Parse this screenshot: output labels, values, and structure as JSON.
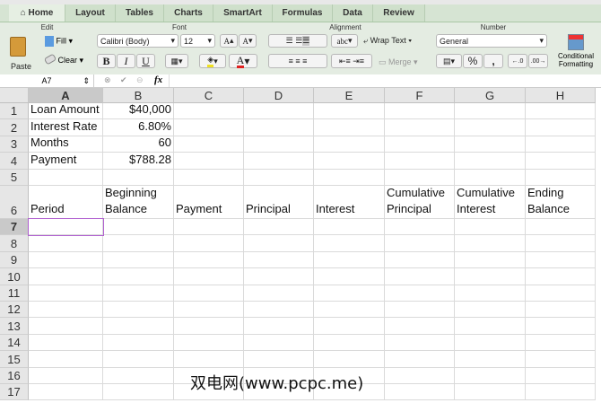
{
  "tabs": [
    "Home",
    "Layout",
    "Tables",
    "Charts",
    "SmartArt",
    "Formulas",
    "Data",
    "Review"
  ],
  "ribbon": {
    "groups": {
      "edit": "Edit",
      "font": "Font",
      "alignment": "Alignment",
      "number": "Number"
    },
    "paste": "Paste",
    "fill": "Fill",
    "clear": "Clear",
    "font_name": "Calibri (Body)",
    "font_size": "12",
    "bold": "B",
    "italic": "I",
    "underline": "U",
    "wrap_text": "Wrap Text",
    "merge": "Merge",
    "number_format": "General",
    "percent": "%",
    "comma": ",",
    "abc": "abc",
    "conditional_formatting": "Conditional Formatting",
    "font_grow": "A",
    "font_shrink": "A",
    "font_color": "A"
  },
  "formula_bar": {
    "name_box": "A7",
    "fx": "fx",
    "value": ""
  },
  "columns": [
    "A",
    "B",
    "C",
    "D",
    "E",
    "F",
    "G",
    "H"
  ],
  "rows": [
    {
      "n": "1",
      "cells": [
        "Loan Amount",
        "$40,000",
        "",
        "",
        "",
        "",
        "",
        ""
      ]
    },
    {
      "n": "2",
      "cells": [
        "Interest Rate",
        "6.80%",
        "",
        "",
        "",
        "",
        "",
        ""
      ]
    },
    {
      "n": "3",
      "cells": [
        "Months",
        "60",
        "",
        "",
        "",
        "",
        "",
        ""
      ]
    },
    {
      "n": "4",
      "cells": [
        "Payment",
        "$788.28",
        "",
        "",
        "",
        "",
        "",
        ""
      ]
    },
    {
      "n": "5",
      "cells": [
        "",
        "",
        "",
        "",
        "",
        "",
        "",
        ""
      ]
    },
    {
      "n": "6",
      "cells": [
        "Period",
        "Beginning\nBalance",
        "Payment",
        "Principal",
        "Interest",
        "Cumulative\nPrincipal",
        "Cumulative\nInterest",
        "Ending\nBalance"
      ]
    },
    {
      "n": "7",
      "cells": [
        "",
        "",
        "",
        "",
        "",
        "",
        "",
        ""
      ]
    },
    {
      "n": "8",
      "cells": [
        "",
        "",
        "",
        "",
        "",
        "",
        "",
        ""
      ]
    },
    {
      "n": "9",
      "cells": [
        "",
        "",
        "",
        "",
        "",
        "",
        "",
        ""
      ]
    },
    {
      "n": "10",
      "cells": [
        "",
        "",
        "",
        "",
        "",
        "",
        "",
        ""
      ]
    },
    {
      "n": "11",
      "cells": [
        "",
        "",
        "",
        "",
        "",
        "",
        "",
        ""
      ]
    },
    {
      "n": "12",
      "cells": [
        "",
        "",
        "",
        "",
        "",
        "",
        "",
        ""
      ]
    },
    {
      "n": "13",
      "cells": [
        "",
        "",
        "",
        "",
        "",
        "",
        "",
        ""
      ]
    },
    {
      "n": "14",
      "cells": [
        "",
        "",
        "",
        "",
        "",
        "",
        "",
        ""
      ]
    },
    {
      "n": "15",
      "cells": [
        "",
        "",
        "",
        "",
        "",
        "",
        "",
        ""
      ]
    },
    {
      "n": "16",
      "cells": [
        "",
        "",
        "",
        "",
        "",
        "",
        "",
        ""
      ]
    },
    {
      "n": "17",
      "cells": [
        "",
        "",
        "",
        "",
        "",
        "",
        "",
        ""
      ]
    }
  ],
  "watermark": "双电网(www.pcpc.me)"
}
